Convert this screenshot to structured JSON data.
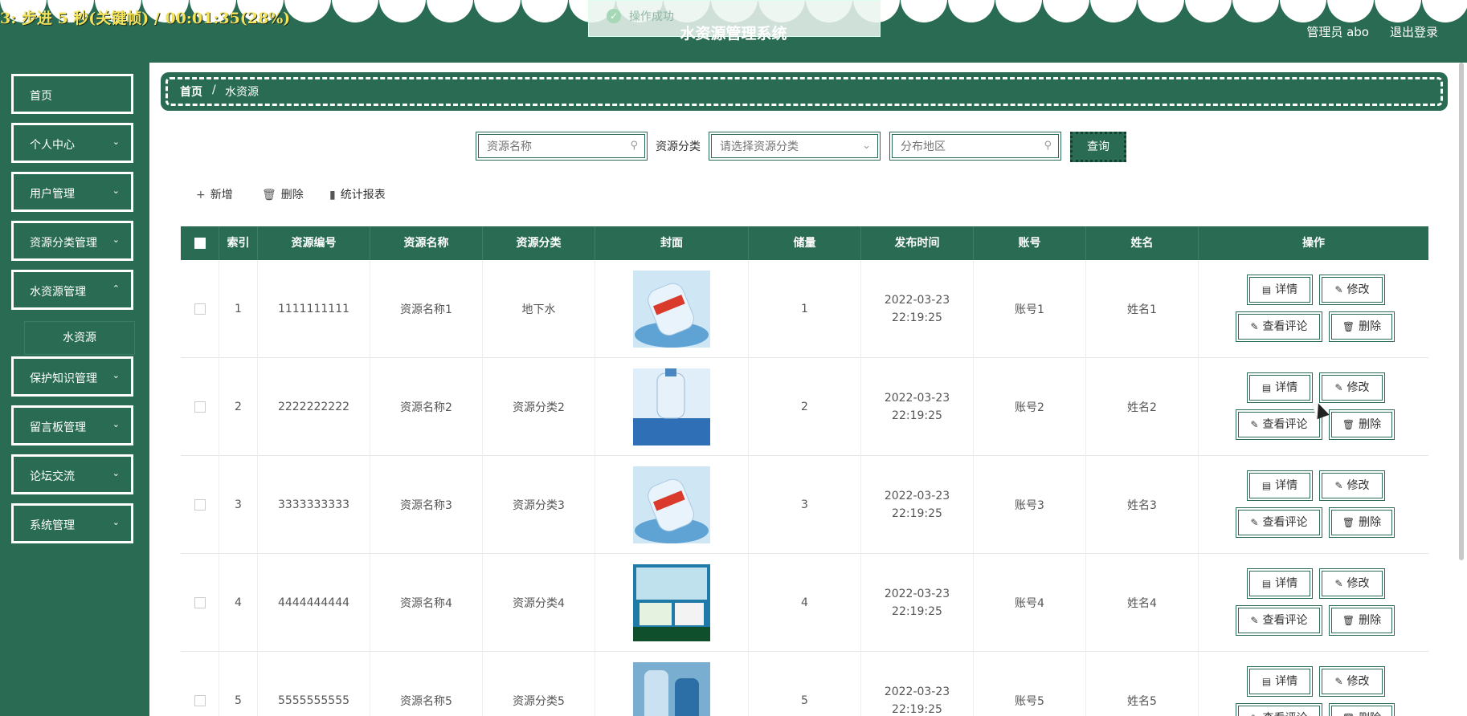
{
  "header": {
    "overlay_text": "3: 步进 5 秒(关键帧) / 00:01:35(28%)",
    "toast": "操作成功",
    "app_title": "水资源管理系统",
    "user": "管理员 abo",
    "logout": "退出登录"
  },
  "sidebar": {
    "items": [
      {
        "label": "首页",
        "chevron": ""
      },
      {
        "label": "个人中心",
        "chevron": "⌄"
      },
      {
        "label": "用户管理",
        "chevron": "⌄"
      },
      {
        "label": "资源分类管理",
        "chevron": "⌄"
      },
      {
        "label": "水资源管理",
        "chevron": "⌃"
      },
      {
        "label": "保护知识管理",
        "chevron": "⌄"
      },
      {
        "label": "留言板管理",
        "chevron": "⌄"
      },
      {
        "label": "论坛交流",
        "chevron": "⌄"
      },
      {
        "label": "系统管理",
        "chevron": "⌄"
      }
    ],
    "submenu": "水资源"
  },
  "breadcrumb": {
    "home": "首页",
    "sep": "/",
    "current": "水资源"
  },
  "search": {
    "name_placeholder": "资源名称",
    "category_label": "资源分类",
    "category_placeholder": "请选择资源分类",
    "region_placeholder": "分布地区",
    "query": "查询"
  },
  "toolbar": {
    "add": "新增",
    "delete": "删除",
    "report": "统计报表"
  },
  "table": {
    "headers": [
      "索引",
      "资源编号",
      "资源名称",
      "资源分类",
      "封面",
      "储量",
      "发布时间",
      "账号",
      "姓名",
      "操作"
    ],
    "rows": [
      {
        "index": "1",
        "code": "1111111111",
        "name": "资源名称1",
        "category": "地下水",
        "stock": "1",
        "time": "2022-03-23 22:19:25",
        "account": "账号1",
        "person": "姓名1"
      },
      {
        "index": "2",
        "code": "2222222222",
        "name": "资源名称2",
        "category": "资源分类2",
        "stock": "2",
        "time": "2022-03-23 22:19:25",
        "account": "账号2",
        "person": "姓名2"
      },
      {
        "index": "3",
        "code": "3333333333",
        "name": "资源名称3",
        "category": "资源分类3",
        "stock": "3",
        "time": "2022-03-23 22:19:25",
        "account": "账号3",
        "person": "姓名3"
      },
      {
        "index": "4",
        "code": "4444444444",
        "name": "资源名称4",
        "category": "资源分类4",
        "stock": "4",
        "time": "2022-03-23 22:19:25",
        "account": "账号4",
        "person": "姓名4"
      },
      {
        "index": "5",
        "code": "5555555555",
        "name": "资源名称5",
        "category": "资源分类5",
        "stock": "5",
        "time": "2022-03-23 22:19:25",
        "account": "账号5",
        "person": "姓名5"
      }
    ],
    "actions": {
      "detail": "详情",
      "edit": "修改",
      "comments": "查看评论",
      "remove": "删除"
    }
  },
  "colors": {
    "primary": "#2a6b53",
    "header_text": "#ffffff",
    "overlay": "#f3e25b"
  }
}
